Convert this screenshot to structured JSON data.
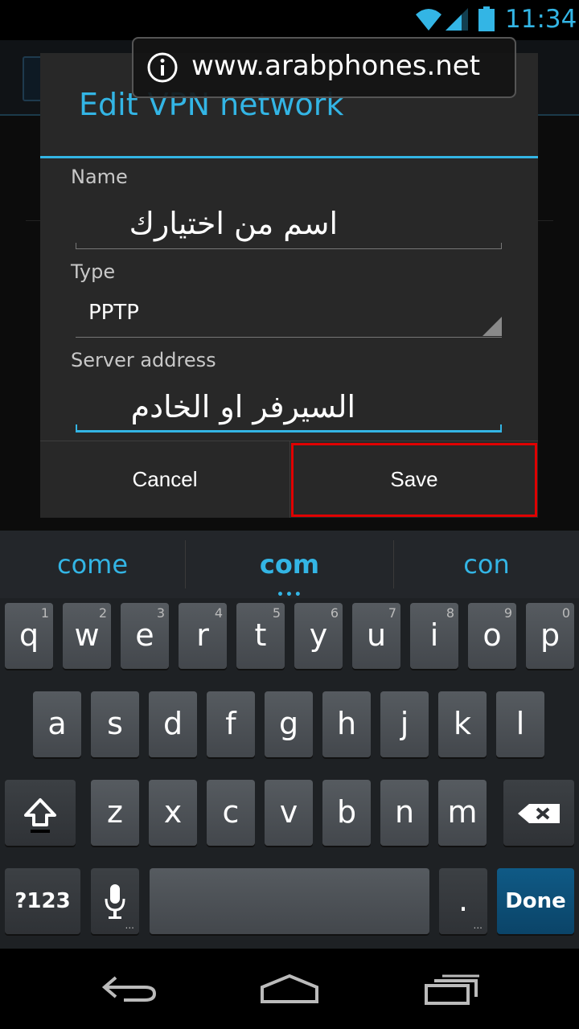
{
  "status_bar": {
    "time": "11:34",
    "accent_color": "#33b5e5",
    "icons": [
      "wifi-icon",
      "signal-icon",
      "battery-icon"
    ]
  },
  "url_overlay": {
    "icon": "info-icon",
    "text": "www.arabphones.net"
  },
  "dialog": {
    "title": "Edit VPN network",
    "fields": {
      "name": {
        "label": "Name",
        "value": "اسم من اختيارك"
      },
      "type": {
        "label": "Type",
        "value": "PPTP"
      },
      "server": {
        "label": "Server address",
        "value": "السيرفر او الخادم"
      }
    },
    "buttons": {
      "cancel": "Cancel",
      "save": "Save"
    },
    "highlight_color": "#e00000"
  },
  "keyboard": {
    "suggestions": [
      "come",
      "com",
      "con"
    ],
    "suggestion_more": "•••",
    "row1": [
      {
        "ch": "q",
        "num": "1"
      },
      {
        "ch": "w",
        "num": "2"
      },
      {
        "ch": "e",
        "num": "3"
      },
      {
        "ch": "r",
        "num": "4"
      },
      {
        "ch": "t",
        "num": "5"
      },
      {
        "ch": "y",
        "num": "6"
      },
      {
        "ch": "u",
        "num": "7"
      },
      {
        "ch": "i",
        "num": "8"
      },
      {
        "ch": "o",
        "num": "9"
      },
      {
        "ch": "p",
        "num": "0"
      }
    ],
    "row2": [
      "a",
      "s",
      "d",
      "f",
      "g",
      "h",
      "j",
      "k",
      "l"
    ],
    "row3": [
      "z",
      "x",
      "c",
      "v",
      "b",
      "n",
      "m"
    ],
    "symbols_key": "?123",
    "period_key": ".",
    "done_key": "Done",
    "key_dots": "..."
  },
  "nav_bar": {
    "icons": [
      "back-icon",
      "home-icon",
      "recent-apps-icon"
    ]
  }
}
